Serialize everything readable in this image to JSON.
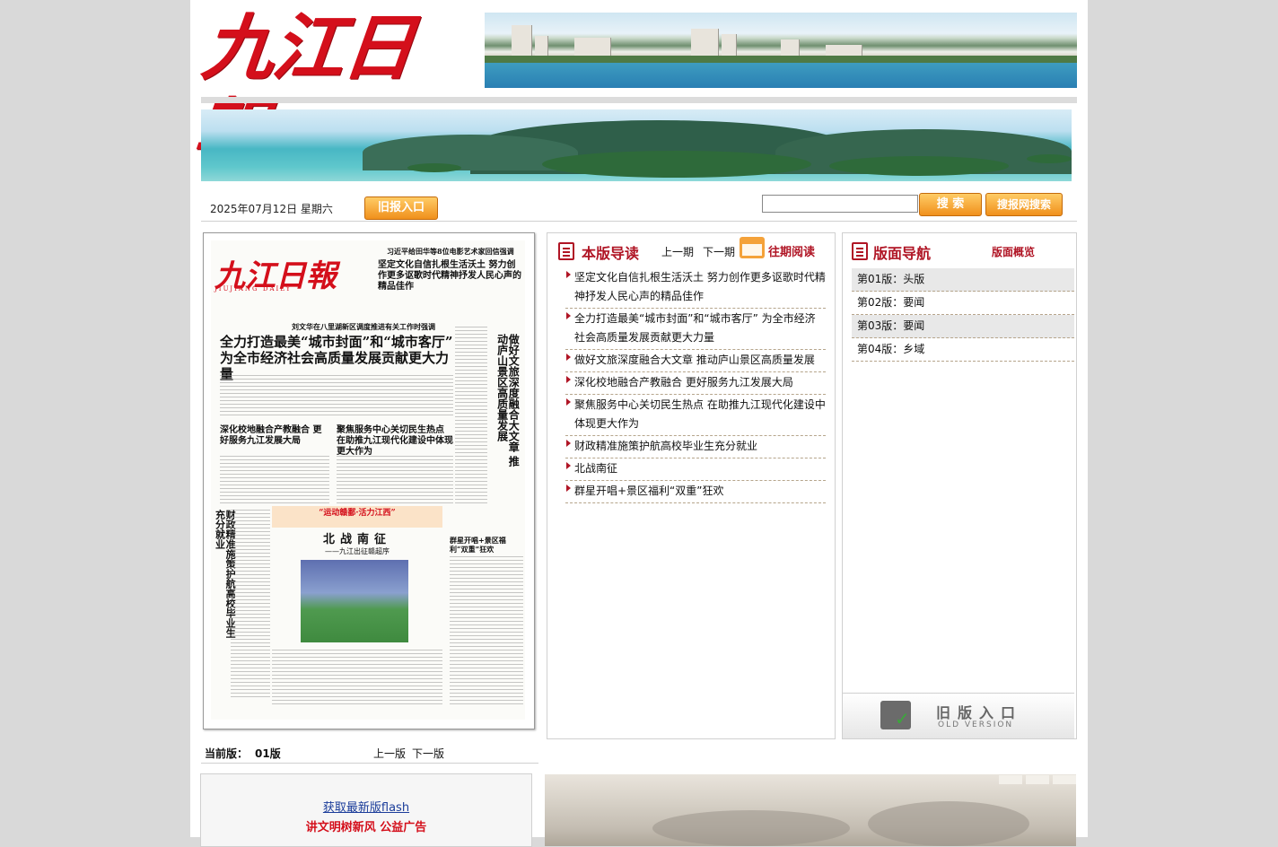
{
  "header": {
    "logo_text": "九江日報"
  },
  "toolbar": {
    "date": "2025年07月12日 星期六",
    "old_paper_button": "旧报入口",
    "search_placeholder": "",
    "search_button": "搜 索",
    "search_net_button": "搜报网搜索"
  },
  "paper_thumb": {
    "logo": "九江日報",
    "logo_sub": "JIUJIANG DAILY",
    "headline_top_kicker": "习近平给田华等8位电影艺术家回信强调",
    "headline_top": "坚定文化自信扎根生活沃土 努力创作更多讴歌时代精神抒发人民心声的精品佳作",
    "kicker_main": "刘文华在八里湖新区调度推进有关工作时强调",
    "headline_main": "全力打造最美“城市封面”和“城市客厅” 为全市经济社会高质量发展贡献更大力量",
    "headline_vert": "做好文旅深度融合大文章 推动庐山景区高质量发展",
    "headline_sub1": "深化校地融合产教融合 更好服务九江发展大局",
    "headline_sub2": "聚焦服务中心关切民生热点 在助推九江现代化建设中体现更大作为",
    "headline_vert2": "财政精准施策护航高校毕业生充分就业",
    "orange_banner": "“运动赣鄱·活力江西”",
    "feature_title": "北战南征",
    "feature_sub": "——九江出征赣超序",
    "right_sub": "群星开唱+景区福利“双重”狂欢"
  },
  "edition": {
    "current_label": "当前版：",
    "current_value": "01版",
    "prev": "上一版",
    "next": "下一版"
  },
  "guide": {
    "title": "本版导读",
    "prev": "上一期",
    "next": "下一期",
    "past": "往期阅读",
    "items": [
      "坚定文化自信扎根生活沃土 努力创作更多讴歌时代精神抒发人民心声的精品佳作",
      "全力打造最美“城市封面”和“城市客厅” 为全市经济社会高质量发展贡献更大力量",
      "做好文旅深度融合大文章 推动庐山景区高质量发展",
      "深化校地融合产教融合 更好服务九江发展大局",
      "聚焦服务中心关切民生热点 在助推九江现代化建设中体现更大作为",
      "财政精准施策护航高校毕业生充分就业",
      "北战南征",
      "群星开唱+景区福利“双重”狂欢"
    ]
  },
  "nav": {
    "title": "版面导航",
    "overview": "版面概览",
    "items": [
      "第01版：头版",
      "第02版：要闻",
      "第03版：要闻",
      "第04版：乡域"
    ],
    "old_version_title": "旧版入口",
    "old_version_sub": "OLD VERSION"
  },
  "bottom": {
    "flash_link": "获取最新版flash",
    "ad_text": "讲文明树新风 公益广告"
  },
  "colors": {
    "brand_red": "#d40f1b",
    "accent_red": "#b01525",
    "button_orange": "#f0901c"
  }
}
